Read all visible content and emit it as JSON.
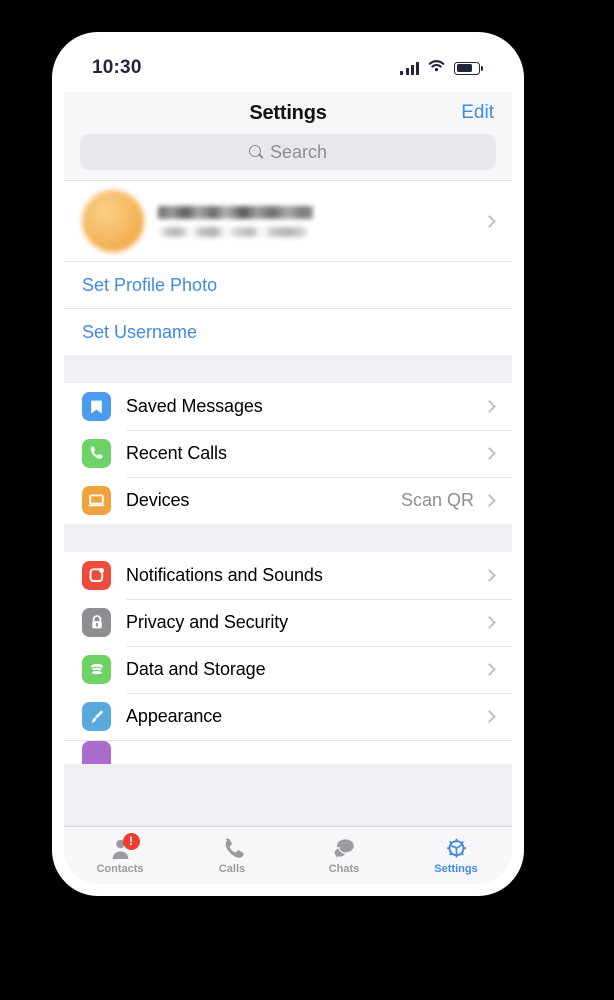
{
  "status_bar": {
    "time": "10:30",
    "signal_icon": "cellular-bars-icon",
    "wifi_icon": "wifi-icon",
    "battery_icon": "battery-icon",
    "battery_level": 74
  },
  "nav": {
    "title": "Settings",
    "edit_label": "Edit"
  },
  "search": {
    "placeholder": "Search",
    "value": "",
    "icon": "search-icon"
  },
  "profile": {
    "avatar_icon": "user-avatar-blurred",
    "avatar_color": "#f1ad4e",
    "name_redacted": true,
    "phone_redacted": true,
    "chevron_icon": "chevron-right-icon"
  },
  "account_links": [
    {
      "label": "Set Profile Photo"
    },
    {
      "label": "Set Username"
    }
  ],
  "groups": [
    {
      "rows": [
        {
          "label": "Saved Messages",
          "icon": "bookmark-icon",
          "color": "#4c9ced",
          "value": "",
          "chevron": true
        },
        {
          "label": "Recent Calls",
          "icon": "phone-icon",
          "color": "#6fd267",
          "value": "",
          "chevron": true
        },
        {
          "label": "Devices",
          "icon": "laptop-icon",
          "color": "#f0a33c",
          "value": "Scan QR",
          "chevron": true
        }
      ]
    },
    {
      "rows": [
        {
          "label": "Notifications and Sounds",
          "icon": "notification-icon",
          "color": "#ee4b3c",
          "value": "",
          "chevron": true
        },
        {
          "label": "Privacy and Security",
          "icon": "lock-icon",
          "color": "#8e8e93",
          "value": "",
          "chevron": true
        },
        {
          "label": "Data and Storage",
          "icon": "database-icon",
          "color": "#6fd267",
          "value": "",
          "chevron": true
        },
        {
          "label": "Appearance",
          "icon": "paintbrush-icon",
          "color": "#5aa9dd",
          "value": "",
          "chevron": true
        }
      ]
    }
  ],
  "partial_row": {
    "icon": "language-icon",
    "color": "#ac6ccd"
  },
  "tabs": [
    {
      "label": "Contacts",
      "icon": "contacts-icon",
      "active": false,
      "badge": "!"
    },
    {
      "label": "Calls",
      "icon": "phone-handset-icon",
      "active": false,
      "badge": ""
    },
    {
      "label": "Chats",
      "icon": "chat-bubbles-icon",
      "active": false,
      "badge": ""
    },
    {
      "label": "Settings",
      "icon": "gear-icon",
      "active": true,
      "badge": ""
    }
  ],
  "colors": {
    "accent": "#3e8ae4",
    "group_bg": "#efeff4",
    "bar_bg": "#f7f7f9",
    "muted_text": "#8e8e93"
  }
}
